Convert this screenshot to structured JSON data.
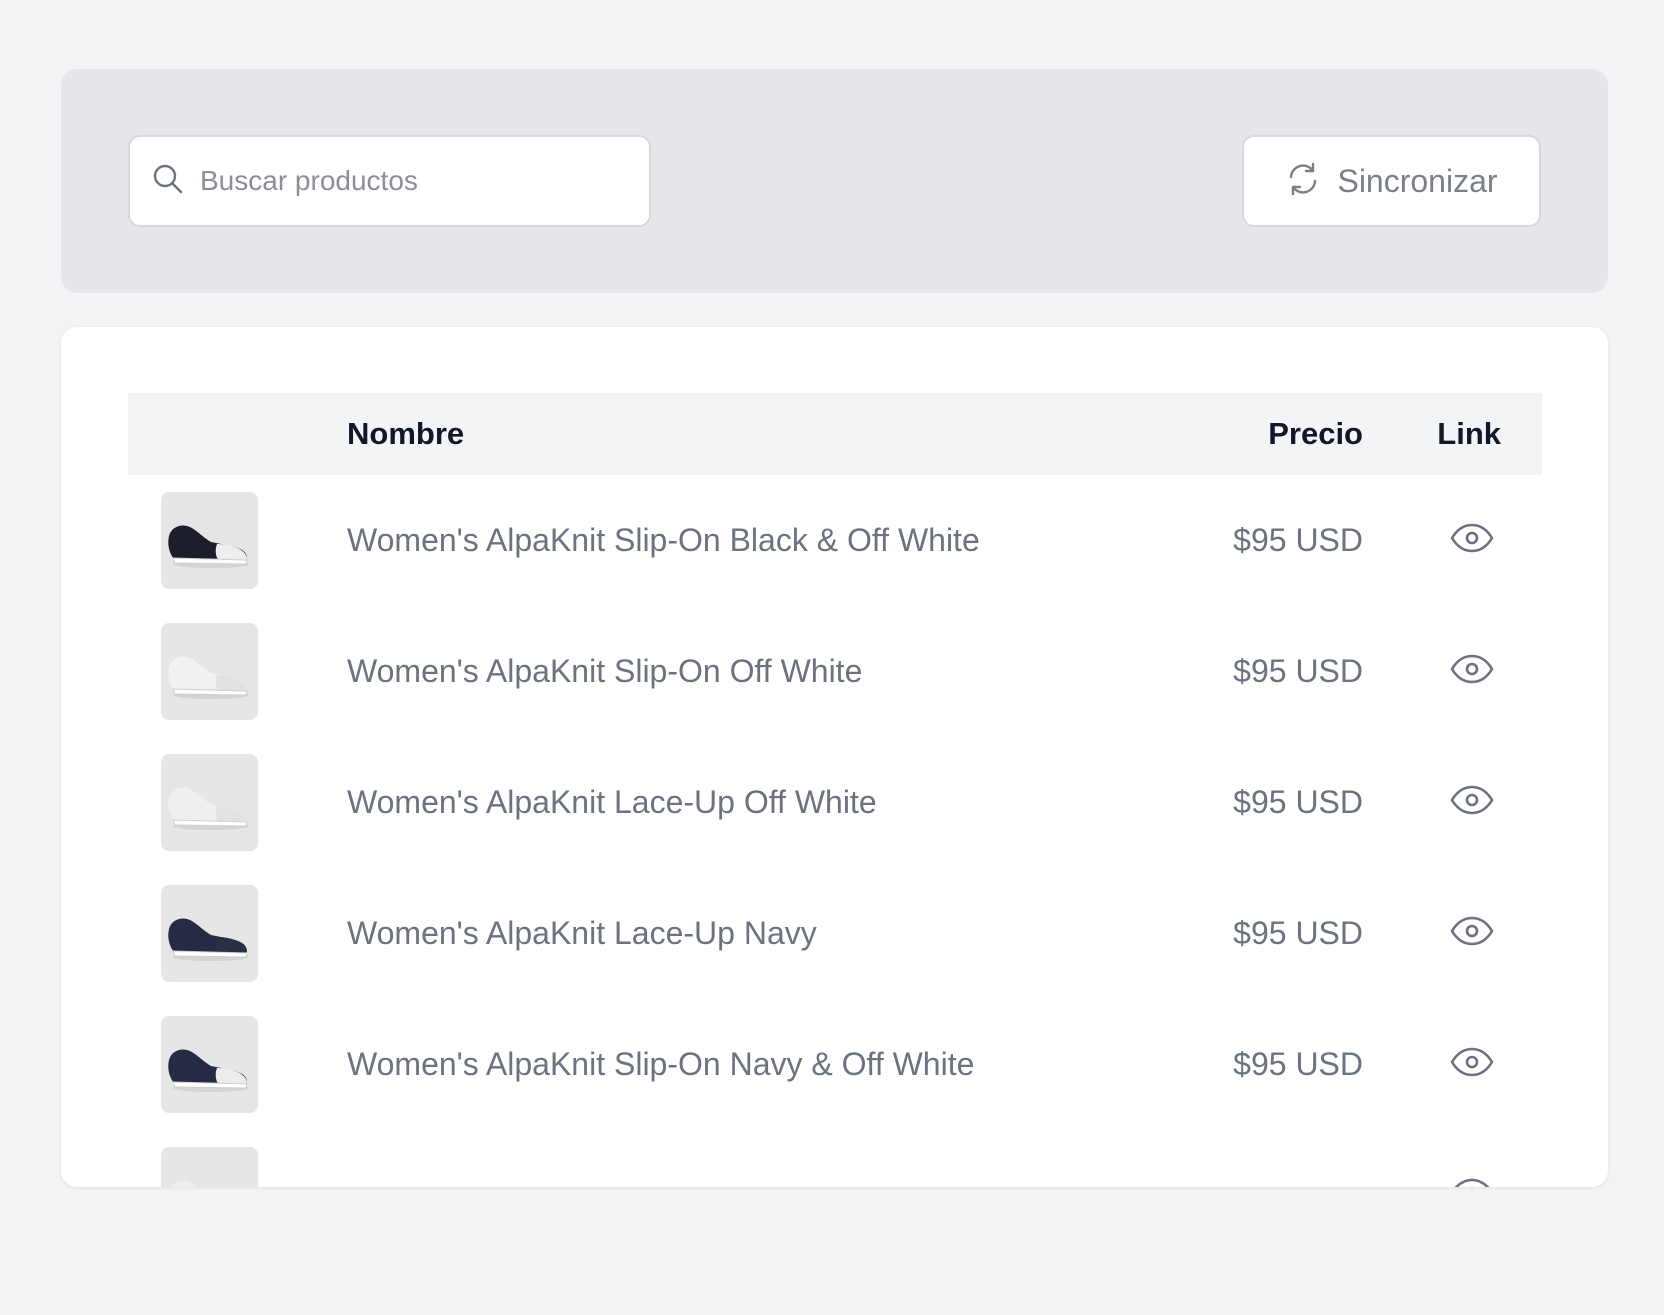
{
  "toolbar": {
    "search": {
      "placeholder": "Buscar productos",
      "value": ""
    },
    "sync_label": "Sincronizar"
  },
  "table": {
    "columns": {
      "image": "",
      "name": "Nombre",
      "price": "Precio",
      "link": "Link"
    },
    "rows": [
      {
        "name": "Women's AlpaKnit Slip-On Black & Off White",
        "price": "$95 USD",
        "shoe_color": "#1c1f2b",
        "toe_color": "#eeeeee"
      },
      {
        "name": "Women's AlpaKnit Slip-On Off White",
        "price": "$95 USD",
        "shoe_color": "#f1f1f1",
        "toe_color": "#e2e2e2"
      },
      {
        "name": "Women's AlpaKnit Lace-Up Off White",
        "price": "$95 USD",
        "shoe_color": "#efefef",
        "toe_color": "#e3e3e3"
      },
      {
        "name": "Women's AlpaKnit Lace-Up Navy",
        "price": "$95 USD",
        "shoe_color": "#262a44",
        "toe_color": "#2b2f45"
      },
      {
        "name": "Women's AlpaKnit Slip-On Navy & Off White",
        "price": "$95 USD",
        "shoe_color": "#262a44",
        "toe_color": "#ececec"
      },
      {
        "name": "",
        "price": "",
        "shoe_color": "#eeeeee",
        "toe_color": "#e2e2e2"
      }
    ]
  },
  "icons": {
    "search": "search-icon",
    "sync": "sync-icon",
    "link": "eye-icon"
  },
  "colors": {
    "background": "#f3f4f6",
    "toolbar_bg": "#e5e7eb",
    "header_bg": "#f3f4f6",
    "text_muted": "#6b7280",
    "text_strong": "#111827"
  }
}
